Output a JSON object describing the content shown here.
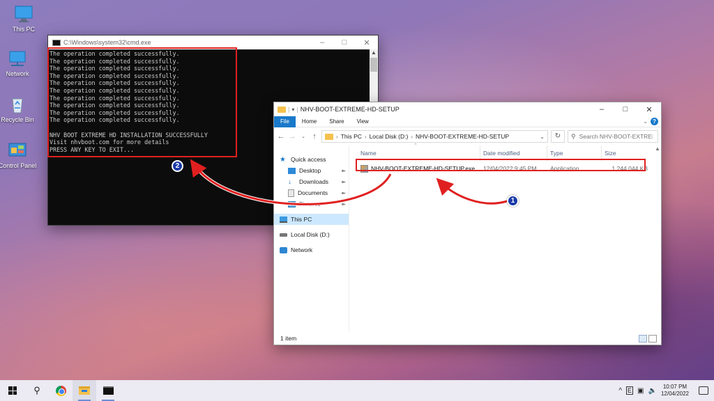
{
  "desktop": {
    "icons": [
      {
        "label": "This PC",
        "icon": "this-pc-icon"
      },
      {
        "label": "Network",
        "icon": "network-icon"
      },
      {
        "label": "Recycle Bin",
        "icon": "recycle-bin-icon"
      },
      {
        "label": "Control Panel",
        "icon": "control-panel-icon"
      }
    ]
  },
  "cmd": {
    "title": "C:\\Windows\\system32\\cmd.exe",
    "lines": [
      "The operation completed successfully.",
      "The operation completed successfully.",
      "The operation completed successfully.",
      "The operation completed successfully.",
      "The operation completed successfully.",
      "The operation completed successfully.",
      "The operation completed successfully.",
      "The operation completed successfully.",
      "The operation completed successfully.",
      "The operation completed successfully.",
      "",
      "NHV BOOT EXTREME HD INSTALLATION SUCCESSFULLY",
      "Visit nhvboot.com for more details",
      "PRESS ANY KEY TO EXIT..."
    ]
  },
  "explorer": {
    "title": "NHV-BOOT-EXTREME-HD-SETUP",
    "ribbon": {
      "file": "File",
      "home": "Home",
      "share": "Share",
      "view": "View"
    },
    "address": {
      "this_pc": "This PC",
      "disk": "Local Disk (D:)",
      "folder": "NHV-BOOT-EXTREME-HD-SETUP"
    },
    "search_placeholder": "Search NHV-BOOT-EXTREME...",
    "nav": {
      "quick_access": "Quick access",
      "desktop": "Desktop",
      "downloads": "Downloads",
      "documents": "Documents",
      "pictures": "Pictures",
      "this_pc": "This PC",
      "local_disk": "Local Disk (D:)",
      "network": "Network"
    },
    "columns": {
      "name": "Name",
      "date": "Date modified",
      "type": "Type",
      "size": "Size"
    },
    "files": [
      {
        "name": "NHV-BOOT-EXTREME-HD-SETUP.exe",
        "date": "12/04/2022 9:45 PM",
        "type": "Application",
        "size": "1,244,044 KB"
      }
    ],
    "status": "1 item"
  },
  "annotations": {
    "badge1": "1",
    "badge2": "2",
    "highlight_color": "#e02020",
    "badge_color": "#1a3aa8"
  },
  "taskbar": {
    "time": "10:07 PM",
    "date": "12/04/2022",
    "tray_chevron": "^",
    "ime": "E"
  }
}
